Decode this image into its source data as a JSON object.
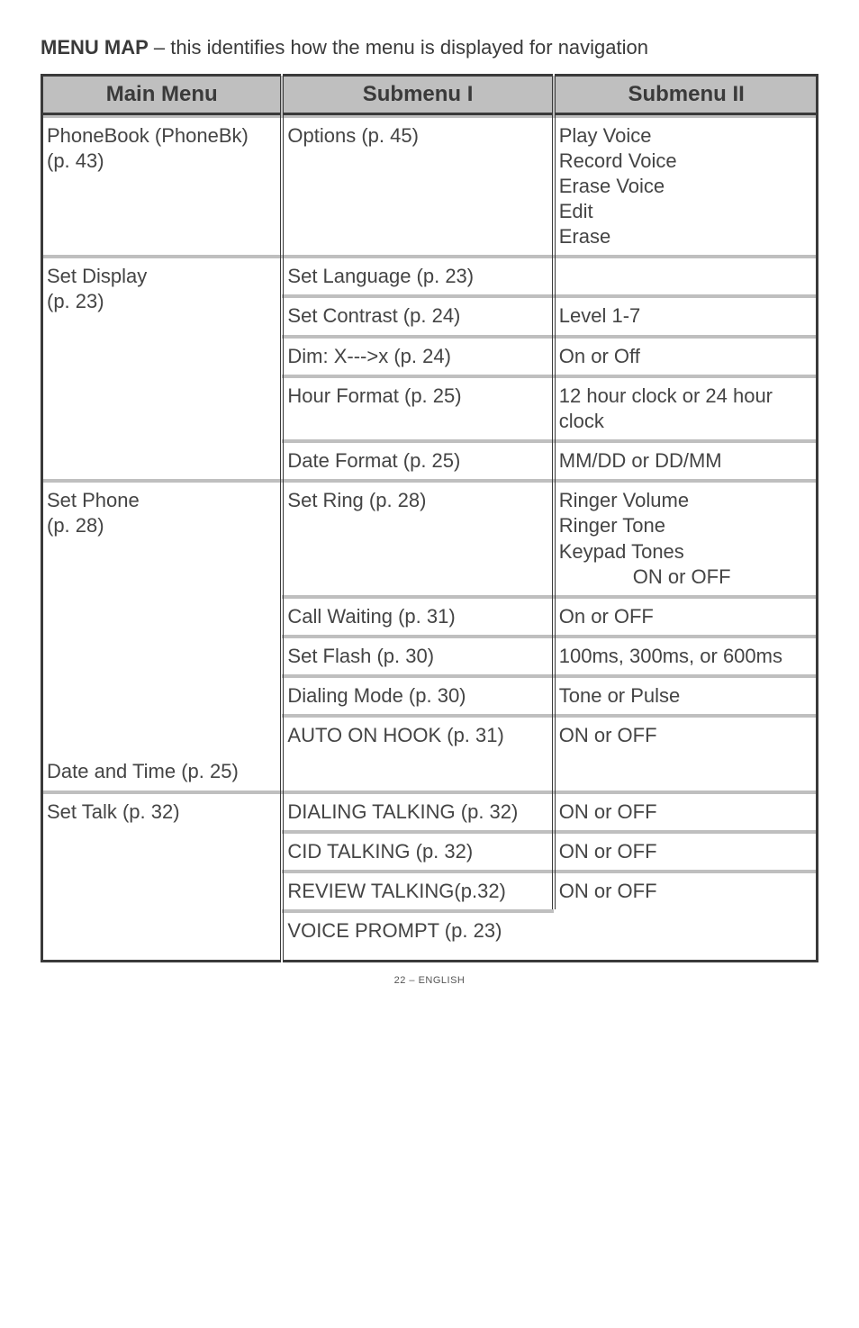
{
  "title_bold": "MENU MAP",
  "title_rest": " – this identifies how the menu is displayed for navigation",
  "headers": {
    "c1": "Main Menu",
    "c2": "Submenu I",
    "c3": "Submenu II"
  },
  "rows": {
    "phonebook_main": "PhoneBook (PhoneBk) (p. 43)",
    "phonebook_sub1": "Options (p. 45)",
    "phonebook_sub2": "Play Voice\nRecord Voice\nErase Voice\nEdit\nErase",
    "setdisplay_main": "Set Display\n(p. 23)",
    "setlang": "Set Language (p. 23)",
    "setcontrast": "Set Contrast (p. 24)",
    "level17": "Level 1-7",
    "dim": "Dim: X--->x (p. 24)",
    "onoff1": "On or Off",
    "hourfmt": "Hour Format (p. 25)",
    "hourfmt2": "12 hour clock or 24 hour clock",
    "datefmt": "Date Format (p. 25)",
    "datefmt2": "MM/DD or DD/MM",
    "setphone_main": "Set Phone\n(p. 28)",
    "setring": "Set Ring (p. 28)",
    "setring2a": "Ringer Volume\nRinger Tone\nKeypad Tones",
    "setring2b": "ON or OFF",
    "callwait": "Call Waiting (p. 31)",
    "callwait2": "On or OFF",
    "setflash": "Set Flash (p. 30)",
    "setflash2": "100ms, 300ms, or 600ms",
    "dialmode": "Dialing Mode (p. 30)",
    "dialmode2": "Tone or Pulse",
    "autohook": "AUTO ON HOOK (p. 31)",
    "autohook2": "ON or OFF",
    "datetime": "Date and Time (p. 25)",
    "settalk_main": "Set Talk (p. 32)",
    "dialtalk": "DIALING TALKING (p. 32)",
    "onoff_on1": "ON or OFF",
    "cidtalk": "CID TALKING (p. 32)",
    "onoff_on2": "ON or OFF",
    "revtalk": "REVIEW TALKING(p.32)",
    "onoff_on3": "ON or OFF",
    "voiceprompt": "VOICE PROMPT (p. 23)"
  },
  "footer": "22 – ENGLISH"
}
